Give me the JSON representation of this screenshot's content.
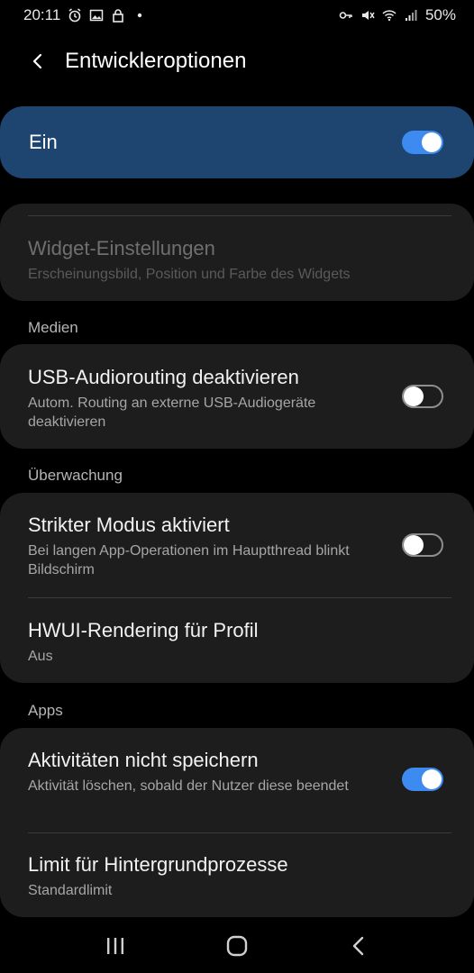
{
  "status_bar": {
    "time": "20:11",
    "left_icons": [
      "alarm-icon",
      "image-icon",
      "lock-icon",
      "dot-icon"
    ],
    "right_icons": [
      "vpn-key-icon",
      "mute-icon",
      "wifi-icon",
      "signal-icon"
    ],
    "battery": "50%"
  },
  "header": {
    "title": "Entwickleroptionen",
    "back_icon": "back-arrow-icon"
  },
  "master": {
    "label": "Ein",
    "enabled": true
  },
  "widget_row": {
    "title": "Widget-Einstellungen",
    "subtitle": "Erscheinungsbild, Position und Farbe des Widgets"
  },
  "sections": {
    "media": "Medien",
    "monitoring": "Überwachung",
    "apps": "Apps"
  },
  "items": {
    "usb_audio": {
      "title": "USB-Audiorouting deaktivieren",
      "subtitle": "Autom. Routing an externe USB-Audiogeräte deaktivieren",
      "enabled": false
    },
    "strict_mode": {
      "title": "Strikter Modus aktiviert",
      "subtitle": "Bei langen App-Operationen im Hauptthread blinkt Bildschirm",
      "enabled": false
    },
    "hwui": {
      "title": "HWUI-Rendering für Profil",
      "subtitle": "Aus"
    },
    "dont_keep": {
      "title": "Aktivitäten nicht speichern",
      "subtitle": "Aktivität löschen, sobald der Nutzer diese beendet",
      "enabled": true
    },
    "bg_limit": {
      "title": "Limit für Hintergrundprozesse",
      "subtitle": "Standardlimit"
    }
  },
  "colors": {
    "accent": "#3d8bf0",
    "master_card": "#1e4470",
    "card": "#1d1d1d",
    "background": "#000000"
  }
}
